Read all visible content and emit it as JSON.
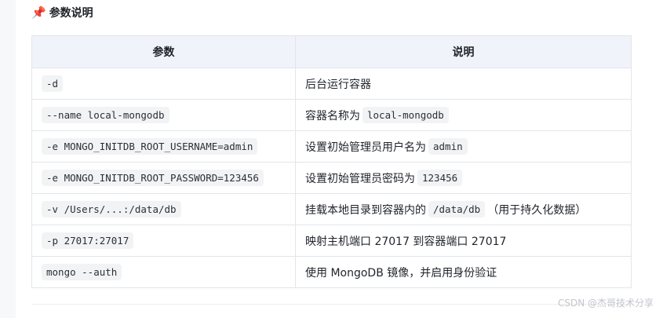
{
  "section": {
    "icon": "pushpin-icon",
    "title": "参数说明"
  },
  "table": {
    "headers": [
      "参数",
      "说明"
    ],
    "rows": [
      {
        "param": "-d",
        "desc": [
          {
            "t": "后台运行容器"
          }
        ]
      },
      {
        "param": "--name local-mongodb",
        "desc": [
          {
            "t": "容器名称为"
          },
          {
            "code": "local-mongodb"
          }
        ]
      },
      {
        "param": "-e MONGO_INITDB_ROOT_USERNAME=admin",
        "desc": [
          {
            "t": "设置初始管理员用户名为"
          },
          {
            "code": "admin"
          }
        ]
      },
      {
        "param": "-e MONGO_INITDB_ROOT_PASSWORD=123456",
        "desc": [
          {
            "t": "设置初始管理员密码为"
          },
          {
            "code": "123456"
          }
        ]
      },
      {
        "param": "-v /Users/...:/data/db",
        "desc": [
          {
            "t": "挂载本地目录到容器内的"
          },
          {
            "code": "/data/db"
          },
          {
            "t": "（用于持久化数据）"
          }
        ]
      },
      {
        "param": "-p 27017:27017",
        "desc": [
          {
            "t": "映射主机端口 27017 到容器端口 27017"
          }
        ]
      },
      {
        "param": "mongo --auth",
        "desc": [
          {
            "t": "使用 MongoDB 镜像，并启用身份验证"
          }
        ]
      }
    ]
  },
  "watermark": "CSDN @杰哥技术分享"
}
